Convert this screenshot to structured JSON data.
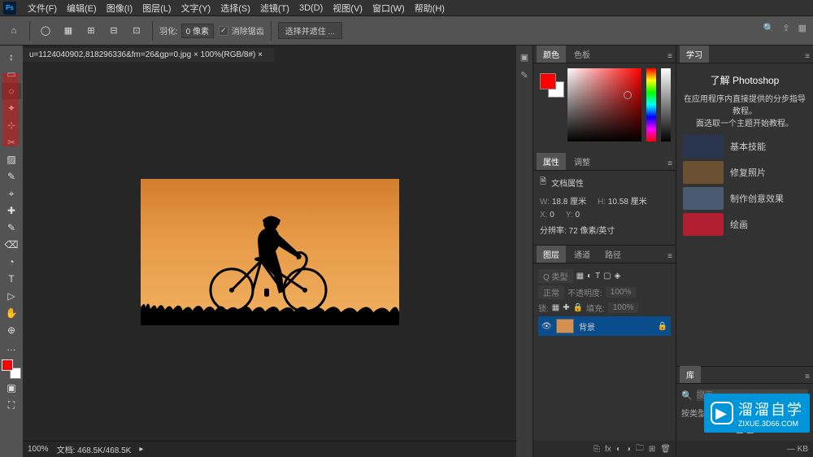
{
  "menu": {
    "items": [
      "文件(F)",
      "编辑(E)",
      "图像(I)",
      "图层(L)",
      "文字(Y)",
      "选择(S)",
      "滤镜(T)",
      "3D(D)",
      "视图(V)",
      "窗口(W)",
      "帮助(H)"
    ]
  },
  "optbar": {
    "feather_label": "羽化:",
    "feather_value": "0 像素",
    "antialias": "消除锯齿",
    "select_shift": "选择并遮住 ..."
  },
  "document": {
    "tab": "u=1124040902,818296336&fm=26&gp=0.jpg × 100%(RGB/8#) ×"
  },
  "status": {
    "zoom": "100%",
    "docsize": "文档: 468.5K/468.5K"
  },
  "tools": [
    "↕",
    "▭",
    "○",
    "✦",
    "⊹",
    "✂",
    "▨",
    "✎",
    "⌖",
    "✚",
    "✎",
    "⌫",
    "◔",
    "T",
    "▷",
    "✋",
    "⊕",
    "…"
  ],
  "colorPanel": {
    "tabs": [
      "颜色",
      "色板"
    ]
  },
  "propsPanel": {
    "tabs": [
      "属性",
      "调整"
    ],
    "title": "文档属性",
    "w_label": "W:",
    "w_value": "18.8 厘米",
    "h_label": "H:",
    "h_value": "10.58 厘米",
    "x_label": "X:",
    "x_value": "0",
    "y_label": "Y:",
    "y_value": "0",
    "resolution": "分辨率: 72 像素/英寸"
  },
  "layersPanel": {
    "tabs": [
      "图层",
      "通道",
      "路径"
    ],
    "kind": "Q 类型",
    "blend": "正常",
    "opacity_label": "不透明度:",
    "opacity": "100%",
    "lock_label": "锁:",
    "fill_label": "填充:",
    "fill": "100%",
    "layer_name": "背景"
  },
  "learnPanel": {
    "tab": "学习",
    "title": "了解 Photoshop",
    "desc1": "在应用程序内直接提供的分步指导教程。",
    "desc2": "面选取一个主题开始教程。",
    "items": [
      "基本技能",
      "修复照片",
      "制作创意效果",
      "绘画"
    ]
  },
  "libPanel": {
    "tab": "库",
    "search_placeholder": "搜索",
    "filter": "按类型查看",
    "empty": "Libraries。您\n"
  },
  "topRight": {
    "kb": "— KB"
  },
  "watermark": {
    "brand": "溜溜自学",
    "url": "ZIXUE.3D66.COM"
  }
}
